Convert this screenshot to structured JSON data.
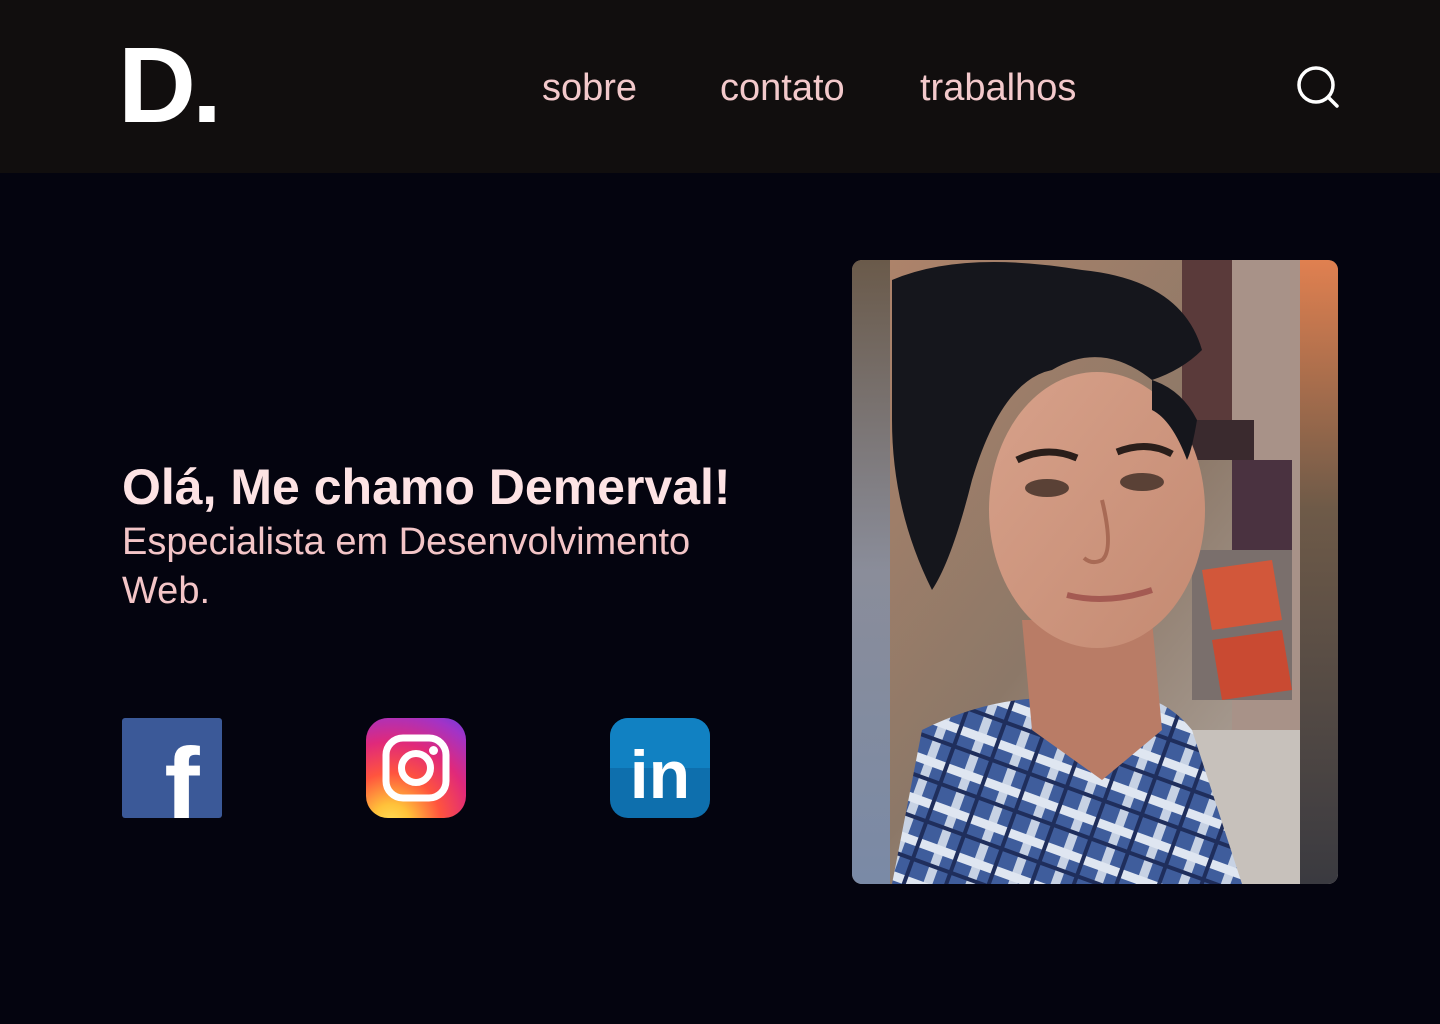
{
  "header": {
    "logo": "D.",
    "nav": {
      "sobre": "sobre",
      "contato": "contato",
      "trabalhos": "trabalhos"
    },
    "search_icon": "search-icon"
  },
  "hero": {
    "title": "Olá, Me chamo Demerval!",
    "subtitle": "Especialista em Desenvolvimento Web."
  },
  "social": [
    {
      "network": "facebook",
      "icon": "facebook-icon",
      "letter": "f",
      "color": "#3b5998"
    },
    {
      "network": "instagram",
      "icon": "instagram-icon",
      "color": "#d62976"
    },
    {
      "network": "linkedin",
      "icon": "linkedin-icon",
      "letter": "in",
      "color": "#0e76a8"
    }
  ],
  "colors": {
    "header_bg": "#110e0e",
    "page_bg": "#04040f",
    "nav_text": "#f3c9cb",
    "title_text": "#fde3e4",
    "subtitle_text": "#f3c5c7"
  }
}
